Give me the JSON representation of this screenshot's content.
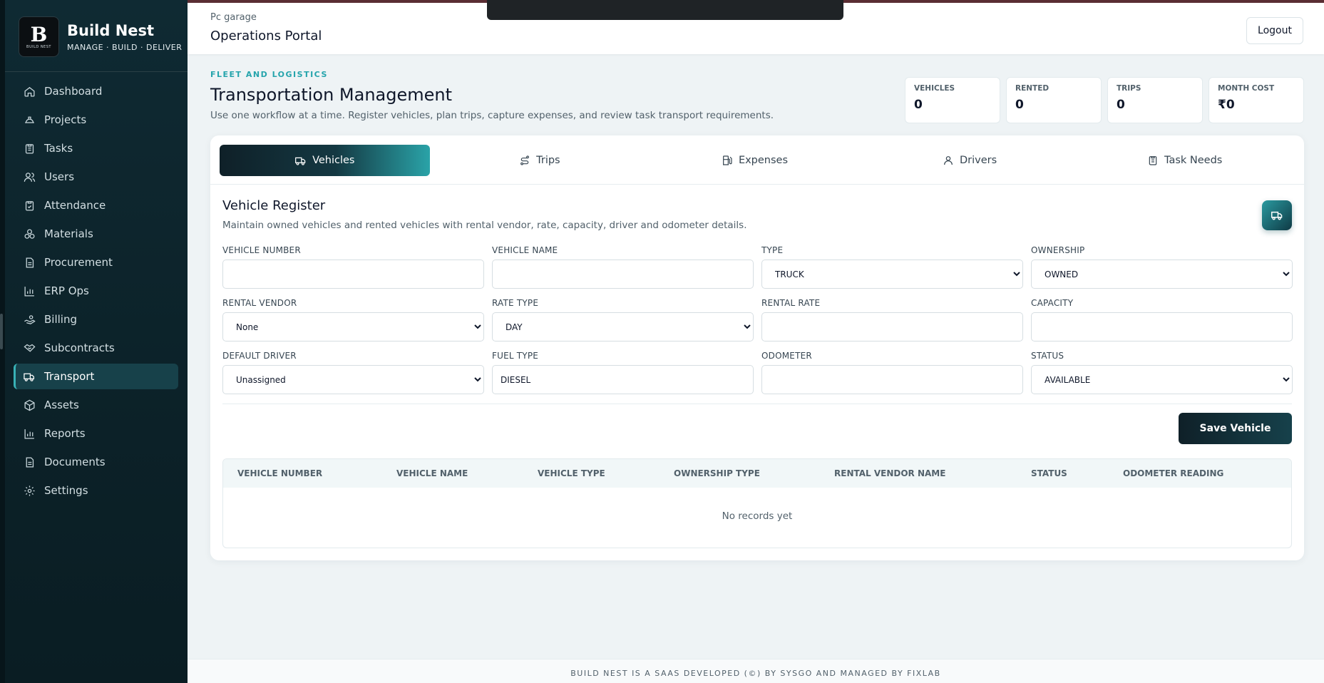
{
  "brand": {
    "name": "Build Nest",
    "tagline": "MANAGE · BUILD · DELIVER",
    "logo_mark": "B",
    "logo_text": "BUILD NEST"
  },
  "sidebar": {
    "items": [
      {
        "label": "Dashboard",
        "icon": "home-icon"
      },
      {
        "label": "Projects",
        "icon": "helmet-icon"
      },
      {
        "label": "Tasks",
        "icon": "clipboard-icon"
      },
      {
        "label": "Users",
        "icon": "users-icon"
      },
      {
        "label": "Attendance",
        "icon": "clipboard-check-icon"
      },
      {
        "label": "Materials",
        "icon": "boxes-icon"
      },
      {
        "label": "Procurement",
        "icon": "document-icon"
      },
      {
        "label": "ERP Ops",
        "icon": "bar-chart-icon"
      },
      {
        "label": "Billing",
        "icon": "hand-coins-icon"
      },
      {
        "label": "Subcontracts",
        "icon": "handshake-icon"
      },
      {
        "label": "Transport",
        "icon": "truck-icon",
        "active": true
      },
      {
        "label": "Assets",
        "icon": "package-icon"
      },
      {
        "label": "Reports",
        "icon": "bar-chart-icon"
      },
      {
        "label": "Documents",
        "icon": "document-icon"
      },
      {
        "label": "Settings",
        "icon": "gear-icon"
      }
    ]
  },
  "header": {
    "org": "Pc garage",
    "portal": "Operations Portal",
    "logout_label": "Logout"
  },
  "page": {
    "eyebrow": "FLEET AND LOGISTICS",
    "title": "Transportation Management",
    "subtitle": "Use one workflow at a time. Register vehicles, plan trips, capture expenses, and review task transport requirements."
  },
  "stats": [
    {
      "label": "VEHICLES",
      "value": "0"
    },
    {
      "label": "RENTED",
      "value": "0"
    },
    {
      "label": "TRIPS",
      "value": "0"
    },
    {
      "label": "MONTH COST",
      "value": "₹0"
    }
  ],
  "tabs": [
    {
      "label": "Vehicles",
      "icon": "truck-icon",
      "active": true
    },
    {
      "label": "Trips",
      "icon": "route-icon"
    },
    {
      "label": "Expenses",
      "icon": "fuel-icon"
    },
    {
      "label": "Drivers",
      "icon": "user-icon"
    },
    {
      "label": "Task Needs",
      "icon": "clipboard-icon"
    }
  ],
  "form": {
    "title": "Vehicle Register",
    "subtitle": "Maintain owned vehicles and rented vehicles with rental vendor, rate, capacity, driver and odometer details.",
    "fields": {
      "vehicle_number": {
        "label": "VEHICLE NUMBER",
        "value": ""
      },
      "vehicle_name": {
        "label": "VEHICLE NAME",
        "value": ""
      },
      "type": {
        "label": "TYPE",
        "value": "TRUCK"
      },
      "ownership": {
        "label": "OWNERSHIP",
        "value": "OWNED"
      },
      "rental_vendor": {
        "label": "RENTAL VENDOR",
        "value": "None"
      },
      "rate_type": {
        "label": "RATE TYPE",
        "value": "DAY"
      },
      "rental_rate": {
        "label": "RENTAL RATE",
        "value": ""
      },
      "capacity": {
        "label": "CAPACITY",
        "value": ""
      },
      "default_driver": {
        "label": "DEFAULT DRIVER",
        "value": "Unassigned"
      },
      "fuel_type": {
        "label": "FUEL TYPE",
        "value": "DIESEL"
      },
      "odometer": {
        "label": "ODOMETER",
        "value": ""
      },
      "status": {
        "label": "STATUS",
        "value": "AVAILABLE"
      }
    },
    "save_label": "Save Vehicle"
  },
  "table": {
    "columns": [
      "VEHICLE NUMBER",
      "VEHICLE NAME",
      "VEHICLE TYPE",
      "OWNERSHIP TYPE",
      "RENTAL VENDOR NAME",
      "STATUS",
      "ODOMETER READING"
    ],
    "empty_text": "No records yet"
  },
  "footer": "BUILD NEST IS A SAAS DEVELOPED (©) BY SYSGO AND MANAGED BY FIXLAB",
  "colors": {
    "accent": "#2aa3a8",
    "sidebar": "#0f2a33",
    "active_nav": "#17414a"
  }
}
